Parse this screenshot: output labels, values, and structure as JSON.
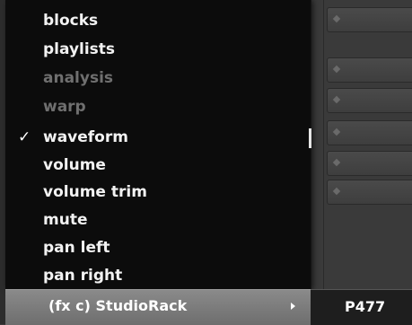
{
  "menu": {
    "items": [
      {
        "label": "blocks",
        "checked": false,
        "disabled": false
      },
      {
        "label": "playlists",
        "checked": false,
        "disabled": false
      },
      {
        "label": "analysis",
        "checked": false,
        "disabled": true
      },
      {
        "label": "warp",
        "checked": false,
        "disabled": true
      },
      {
        "label": "waveform",
        "checked": true,
        "disabled": false,
        "check_mark": "✓"
      },
      {
        "label": "volume",
        "checked": false,
        "disabled": false
      },
      {
        "label": "volume trim",
        "checked": false,
        "disabled": false
      },
      {
        "label": "mute",
        "checked": false,
        "disabled": false
      },
      {
        "label": "pan left",
        "checked": false,
        "disabled": false
      },
      {
        "label": "pan right",
        "checked": false,
        "disabled": false
      }
    ],
    "submenu_item": {
      "label": "(fx c) StudioRack",
      "icon": "submenu-arrow-icon"
    }
  },
  "track_name": "P477",
  "colors": {
    "menu_bg": "#0a0a0a",
    "highlight": "#7c7c7c",
    "disabled_text": "#6f6f6f"
  }
}
